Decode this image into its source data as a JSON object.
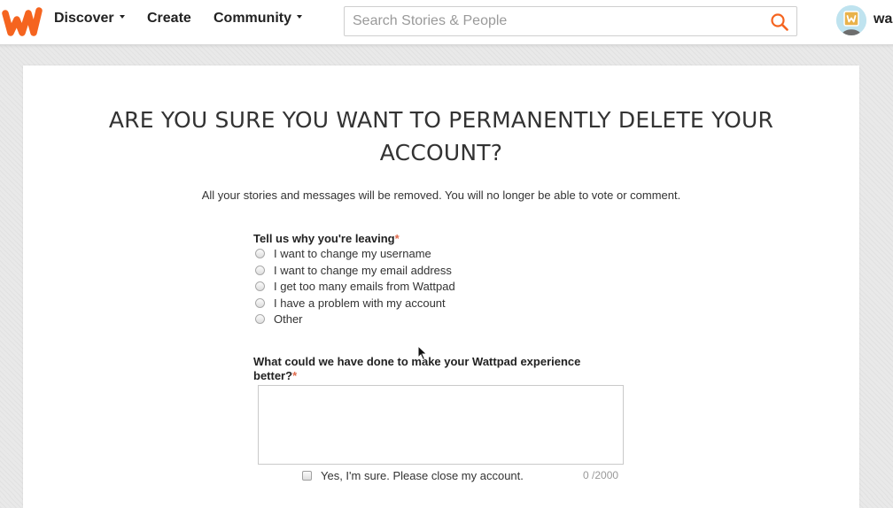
{
  "header": {
    "nav": {
      "discover": "Discover",
      "create": "Create",
      "community": "Community"
    },
    "search": {
      "placeholder": "Search Stories & People"
    },
    "username": "wa"
  },
  "colors": {
    "brand": "#f5641f",
    "required": "#e06a4c"
  },
  "main": {
    "title": "ARE YOU SURE YOU WANT TO PERMANENTLY DELETE YOUR ACCOUNT?",
    "subtitle": "All your stories and messages will be removed. You will no longer be able to vote or comment.",
    "reason": {
      "label": "Tell us why you're leaving",
      "required_mark": "*",
      "options": [
        "I want to change my username",
        "I want to change my email address",
        "I get too many emails from Wattpad",
        "I have a problem with my account",
        "Other"
      ]
    },
    "feedback": {
      "label": "What could we have done to make your Wattpad experience better?",
      "required_mark": "*"
    },
    "confirm": {
      "label": "Yes, I'm sure. Please close my account."
    },
    "char_counter": "0 /2000"
  }
}
